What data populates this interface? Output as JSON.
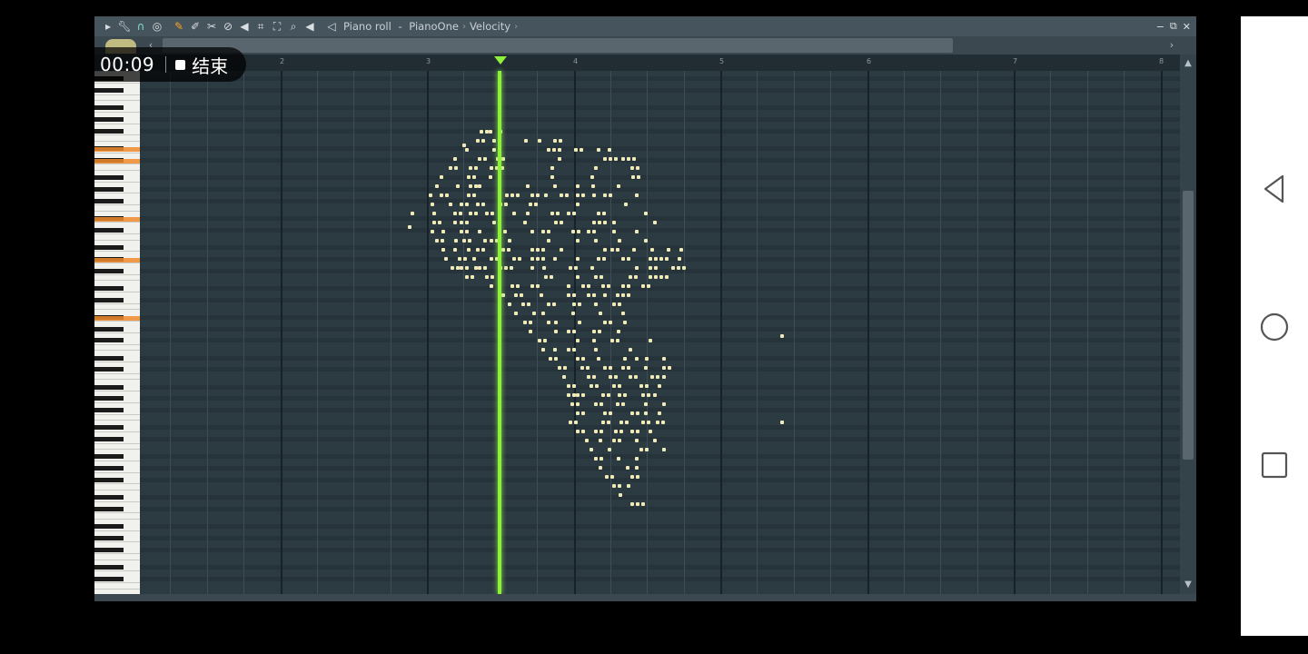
{
  "titlebar": {
    "breadcrumb": [
      "Piano roll",
      "PianoOne",
      "Velocity"
    ],
    "sep1": " - ",
    "sep2": "›",
    "trail": "›",
    "icons": [
      "arrow-right-icon",
      "wrench-icon",
      "magnet-icon",
      "target-icon",
      "pencil-icon",
      "brush-icon",
      "delete-icon",
      "mute-icon",
      "speaker-mute-icon",
      "slice-icon",
      "select-icon",
      "zoom-icon",
      "playback-icon",
      "speaker-icon"
    ],
    "win_buttons": {
      "minimize": "−",
      "restore": "⧉",
      "close": "✕"
    }
  },
  "ruler": {
    "bars": [
      "2",
      "3",
      "4",
      "5",
      "6",
      "7",
      "8"
    ]
  },
  "recording": {
    "time": "00:09",
    "stop_label": "结束"
  },
  "colors": {
    "playhead": "#8ef03c",
    "note": "#f0eab8",
    "grid_bg": "#2c3a42",
    "key_highlight": "#f08a2a"
  },
  "android_nav": [
    "back-icon",
    "home-icon",
    "recents-icon"
  ]
}
